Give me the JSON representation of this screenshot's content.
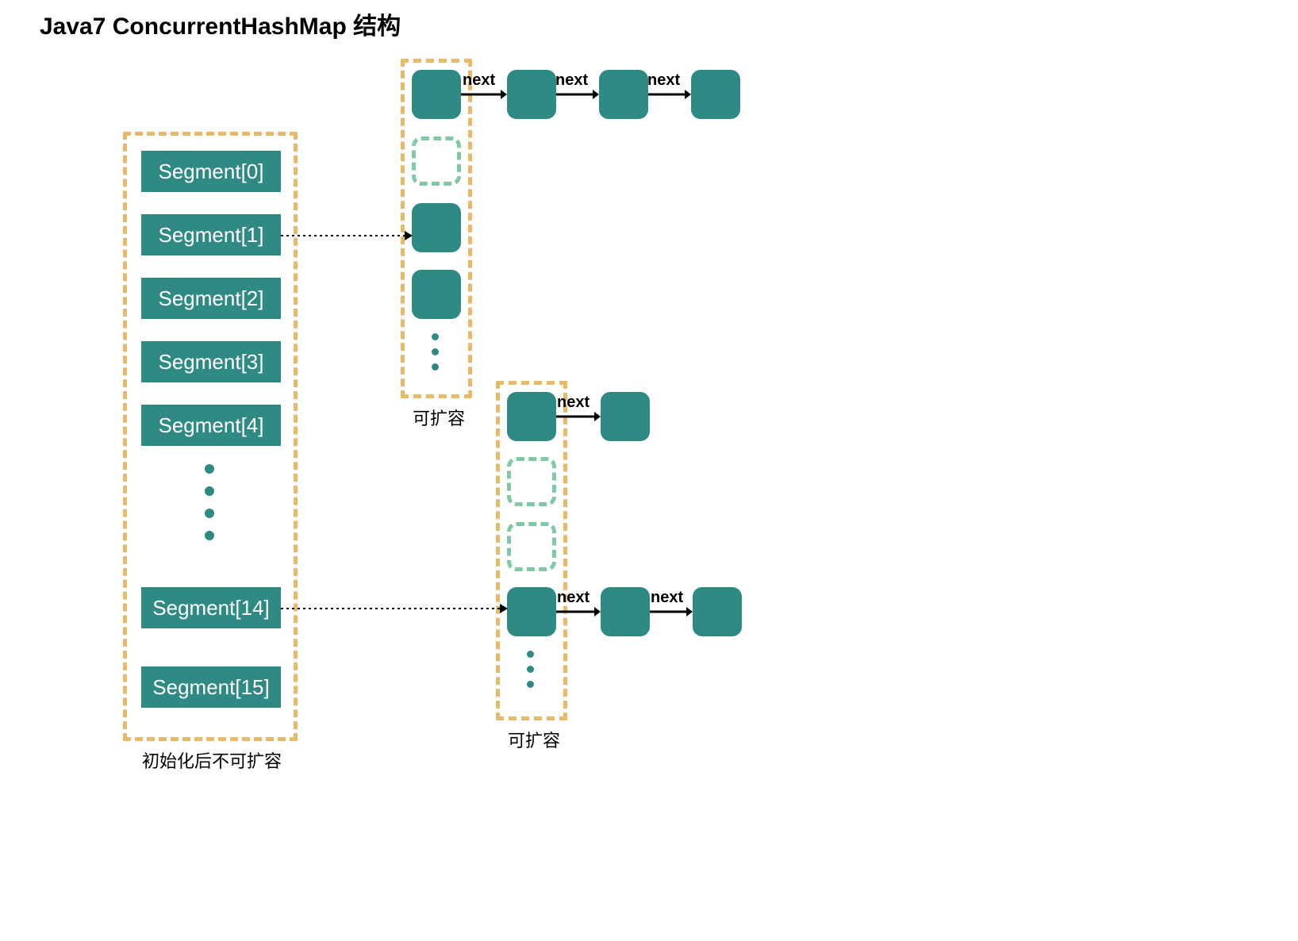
{
  "title": "Java7 ConcurrentHashMap 结构",
  "segments": {
    "s0": "Segment[0]",
    "s1": "Segment[1]",
    "s2": "Segment[2]",
    "s3": "Segment[3]",
    "s4": "Segment[4]",
    "s14": "Segment[14]",
    "s15": "Segment[15]"
  },
  "captions": {
    "segmentArray": "初始化后不可扩容",
    "bucket1": "可扩容",
    "bucket2": "可扩容"
  },
  "linkLabel": "next"
}
